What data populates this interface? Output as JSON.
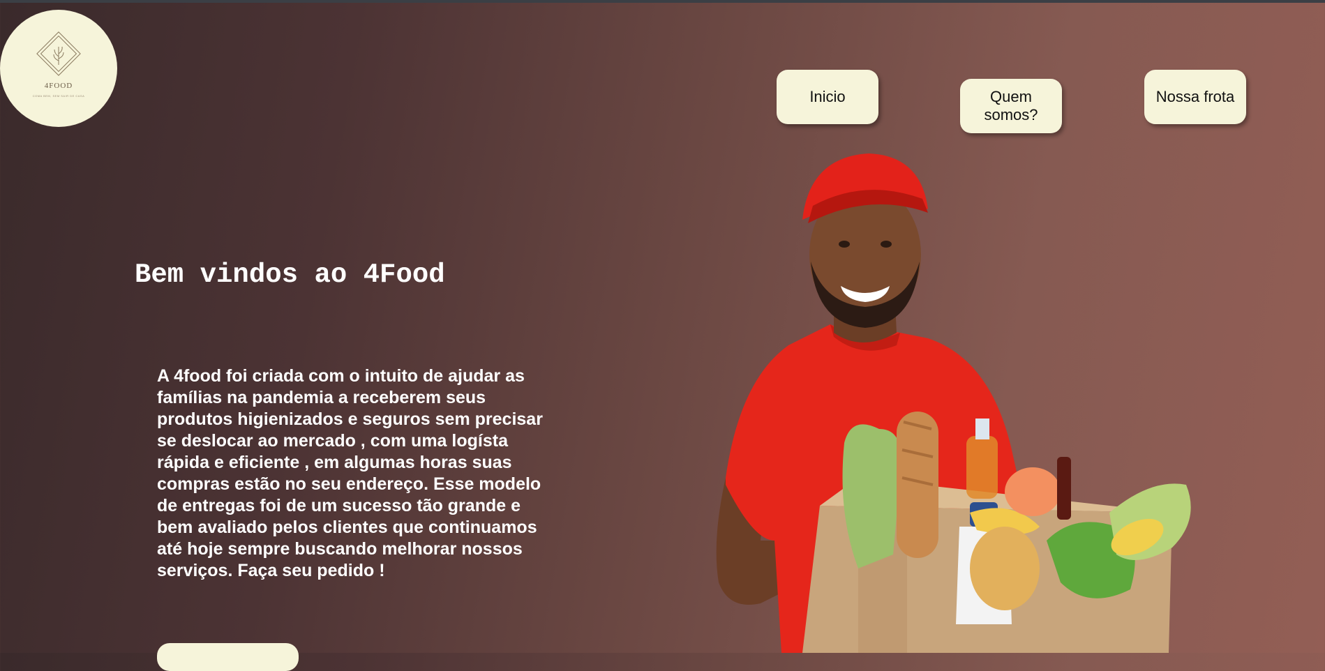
{
  "brand": {
    "name": "4FOOD",
    "tagline": "COMA BEM, SEM SAIR DE CASA"
  },
  "nav": {
    "items": [
      {
        "label": "Inicio"
      },
      {
        "label": "Quem somos?"
      },
      {
        "label": "Nossa frota"
      }
    ]
  },
  "hero": {
    "title": "Bem vindos ao 4Food",
    "text": "A 4food foi criada com o intuito de ajudar as famílias na pandemia a receberem seus produtos higienizados e seguros sem precisar se deslocar ao mercado , com uma logísta rápida e eficiente , em algumas horas suas compras estão no seu endereço. Esse modelo de entregas foi de um sucesso tão grande e bem avaliado pelos clientes que continuamos até hoje sempre buscando melhorar nossos serviços. Faça seu pedido !"
  },
  "colors": {
    "accent": "#f6f4da",
    "gradient_start": "#3a2a2b",
    "gradient_end": "#935e55",
    "text": "#ffffff"
  },
  "image": {
    "icon": "delivery-man-with-grocery-box"
  }
}
